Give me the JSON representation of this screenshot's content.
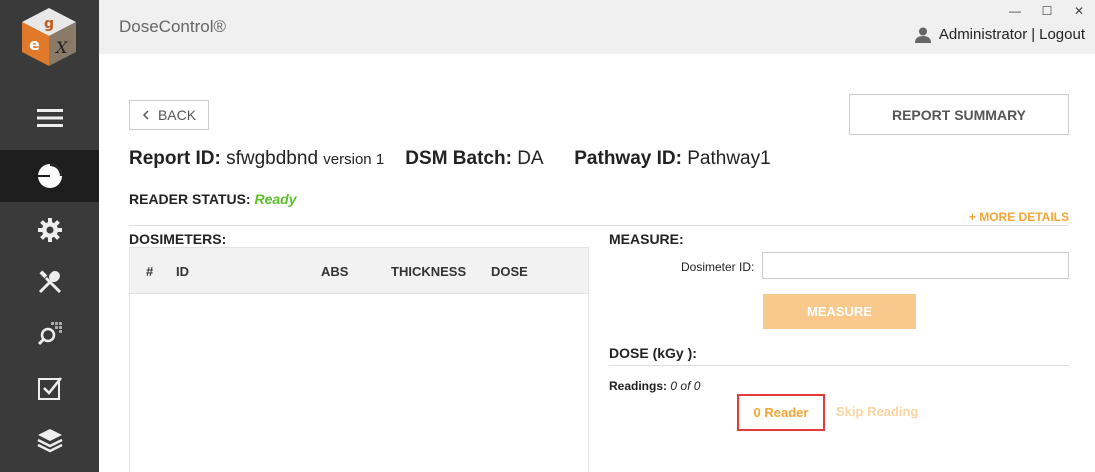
{
  "app": {
    "title": "DoseControl®"
  },
  "window_controls": {
    "minimize": "—",
    "maximize": "☐",
    "close": "✕"
  },
  "user": {
    "name": "Administrator",
    "separator": "|",
    "logout": "Logout"
  },
  "sidebar": {
    "items": [
      {
        "icon": "hamburger-menu-icon"
      },
      {
        "icon": "dashboard-pie-icon",
        "active": true
      },
      {
        "icon": "gear-icon"
      },
      {
        "icon": "tools-icon"
      },
      {
        "icon": "search-grid-icon"
      },
      {
        "icon": "checkbox-icon"
      },
      {
        "icon": "layers-icon"
      }
    ]
  },
  "header": {
    "back_label": "BACK",
    "report_summary_label": "REPORT SUMMARY",
    "report_id_label": "Report ID:",
    "report_id_value": "sfwgbdbnd",
    "version_text": "version 1",
    "dsm_batch_label": "DSM Batch:",
    "dsm_batch_value": "DA",
    "pathway_id_label": "Pathway ID:",
    "pathway_id_value": "Pathway1"
  },
  "status": {
    "reader_status_label": "READER STATUS:",
    "reader_status_value": "Ready",
    "more_details_label": "+ MORE DETAILS"
  },
  "dosimeters": {
    "title": "DOSIMETERS:",
    "columns": [
      "#",
      "ID",
      "ABS",
      "THICKNESS",
      "DOSE"
    ],
    "rows": []
  },
  "measure": {
    "title": "MEASURE:",
    "dosimeter_id_label": "Dosimeter ID:",
    "dosimeter_id_value": "",
    "measure_button": "MEASURE"
  },
  "dose": {
    "title": "DOSE (kGy ):",
    "readings_label": "Readings:",
    "readings_current": "0",
    "readings_of": "of",
    "readings_total": "0",
    "reader_button": "0 Reader",
    "skip_button": "Skip Reading"
  },
  "colors": {
    "sidebar_bg": "#3a3a3a",
    "sidebar_active": "#1e1e1e",
    "accent_orange": "#f5a533",
    "status_green": "#5cc02b",
    "highlight_red": "#e53a3a"
  }
}
